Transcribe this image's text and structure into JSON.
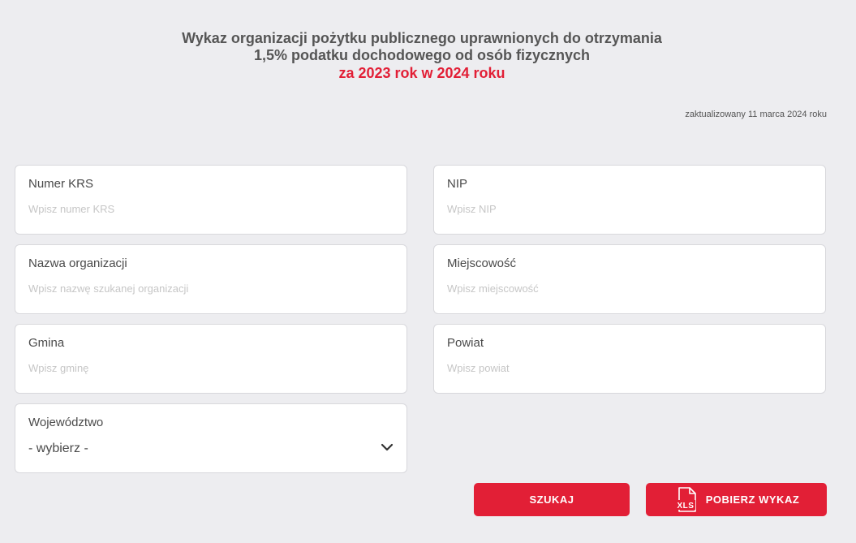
{
  "header": {
    "title_line1": "Wykaz organizacji pożytku publicznego uprawnionych do otrzymania",
    "title_line2": "1,5% podatku dochodowego od osób fizycznych",
    "title_line3": "za 2023 rok w 2024 roku",
    "updated": "zaktualizowany 11 marca 2024 roku"
  },
  "form": {
    "krs": {
      "label": "Numer KRS",
      "placeholder": "Wpisz numer KRS",
      "value": ""
    },
    "nip": {
      "label": "NIP",
      "placeholder": "Wpisz NIP",
      "value": ""
    },
    "name": {
      "label": "Nazwa organizacji",
      "placeholder": "Wpisz nazwę szukanej organizacji",
      "value": ""
    },
    "city": {
      "label": "Miejscowość",
      "placeholder": "Wpisz miejscowość",
      "value": ""
    },
    "gmina": {
      "label": "Gmina",
      "placeholder": "Wpisz gminę",
      "value": ""
    },
    "powiat": {
      "label": "Powiat",
      "placeholder": "Wpisz powiat",
      "value": ""
    },
    "wojewodztwo": {
      "label": "Województwo",
      "selected": "- wybierz -"
    }
  },
  "buttons": {
    "search_label": "SZUKAJ",
    "download_label": "POBIERZ WYKAZ",
    "download_icon": "xls-file-icon",
    "xls_icon_text": "XLS"
  },
  "colors": {
    "accent": "#e21f36",
    "background": "#ededf0"
  }
}
